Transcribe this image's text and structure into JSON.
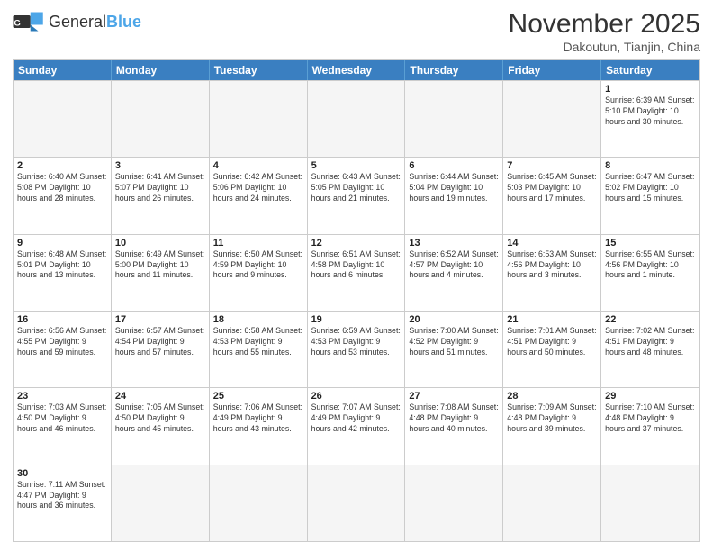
{
  "header": {
    "logo_general": "General",
    "logo_blue": "Blue",
    "month_title": "November 2025",
    "location": "Dakoutun, Tianjin, China"
  },
  "days_of_week": [
    "Sunday",
    "Monday",
    "Tuesday",
    "Wednesday",
    "Thursday",
    "Friday",
    "Saturday"
  ],
  "weeks": [
    [
      {
        "day": "",
        "info": "",
        "empty": true
      },
      {
        "day": "",
        "info": "",
        "empty": true
      },
      {
        "day": "",
        "info": "",
        "empty": true
      },
      {
        "day": "",
        "info": "",
        "empty": true
      },
      {
        "day": "",
        "info": "",
        "empty": true
      },
      {
        "day": "",
        "info": "",
        "empty": true
      },
      {
        "day": "1",
        "info": "Sunrise: 6:39 AM\nSunset: 5:10 PM\nDaylight: 10 hours and 30 minutes.",
        "empty": false
      }
    ],
    [
      {
        "day": "2",
        "info": "Sunrise: 6:40 AM\nSunset: 5:08 PM\nDaylight: 10 hours and 28 minutes.",
        "empty": false
      },
      {
        "day": "3",
        "info": "Sunrise: 6:41 AM\nSunset: 5:07 PM\nDaylight: 10 hours and 26 minutes.",
        "empty": false
      },
      {
        "day": "4",
        "info": "Sunrise: 6:42 AM\nSunset: 5:06 PM\nDaylight: 10 hours and 24 minutes.",
        "empty": false
      },
      {
        "day": "5",
        "info": "Sunrise: 6:43 AM\nSunset: 5:05 PM\nDaylight: 10 hours and 21 minutes.",
        "empty": false
      },
      {
        "day": "6",
        "info": "Sunrise: 6:44 AM\nSunset: 5:04 PM\nDaylight: 10 hours and 19 minutes.",
        "empty": false
      },
      {
        "day": "7",
        "info": "Sunrise: 6:45 AM\nSunset: 5:03 PM\nDaylight: 10 hours and 17 minutes.",
        "empty": false
      },
      {
        "day": "8",
        "info": "Sunrise: 6:47 AM\nSunset: 5:02 PM\nDaylight: 10 hours and 15 minutes.",
        "empty": false
      }
    ],
    [
      {
        "day": "9",
        "info": "Sunrise: 6:48 AM\nSunset: 5:01 PM\nDaylight: 10 hours and 13 minutes.",
        "empty": false
      },
      {
        "day": "10",
        "info": "Sunrise: 6:49 AM\nSunset: 5:00 PM\nDaylight: 10 hours and 11 minutes.",
        "empty": false
      },
      {
        "day": "11",
        "info": "Sunrise: 6:50 AM\nSunset: 4:59 PM\nDaylight: 10 hours and 9 minutes.",
        "empty": false
      },
      {
        "day": "12",
        "info": "Sunrise: 6:51 AM\nSunset: 4:58 PM\nDaylight: 10 hours and 6 minutes.",
        "empty": false
      },
      {
        "day": "13",
        "info": "Sunrise: 6:52 AM\nSunset: 4:57 PM\nDaylight: 10 hours and 4 minutes.",
        "empty": false
      },
      {
        "day": "14",
        "info": "Sunrise: 6:53 AM\nSunset: 4:56 PM\nDaylight: 10 hours and 3 minutes.",
        "empty": false
      },
      {
        "day": "15",
        "info": "Sunrise: 6:55 AM\nSunset: 4:56 PM\nDaylight: 10 hours and 1 minute.",
        "empty": false
      }
    ],
    [
      {
        "day": "16",
        "info": "Sunrise: 6:56 AM\nSunset: 4:55 PM\nDaylight: 9 hours and 59 minutes.",
        "empty": false
      },
      {
        "day": "17",
        "info": "Sunrise: 6:57 AM\nSunset: 4:54 PM\nDaylight: 9 hours and 57 minutes.",
        "empty": false
      },
      {
        "day": "18",
        "info": "Sunrise: 6:58 AM\nSunset: 4:53 PM\nDaylight: 9 hours and 55 minutes.",
        "empty": false
      },
      {
        "day": "19",
        "info": "Sunrise: 6:59 AM\nSunset: 4:53 PM\nDaylight: 9 hours and 53 minutes.",
        "empty": false
      },
      {
        "day": "20",
        "info": "Sunrise: 7:00 AM\nSunset: 4:52 PM\nDaylight: 9 hours and 51 minutes.",
        "empty": false
      },
      {
        "day": "21",
        "info": "Sunrise: 7:01 AM\nSunset: 4:51 PM\nDaylight: 9 hours and 50 minutes.",
        "empty": false
      },
      {
        "day": "22",
        "info": "Sunrise: 7:02 AM\nSunset: 4:51 PM\nDaylight: 9 hours and 48 minutes.",
        "empty": false
      }
    ],
    [
      {
        "day": "23",
        "info": "Sunrise: 7:03 AM\nSunset: 4:50 PM\nDaylight: 9 hours and 46 minutes.",
        "empty": false
      },
      {
        "day": "24",
        "info": "Sunrise: 7:05 AM\nSunset: 4:50 PM\nDaylight: 9 hours and 45 minutes.",
        "empty": false
      },
      {
        "day": "25",
        "info": "Sunrise: 7:06 AM\nSunset: 4:49 PM\nDaylight: 9 hours and 43 minutes.",
        "empty": false
      },
      {
        "day": "26",
        "info": "Sunrise: 7:07 AM\nSunset: 4:49 PM\nDaylight: 9 hours and 42 minutes.",
        "empty": false
      },
      {
        "day": "27",
        "info": "Sunrise: 7:08 AM\nSunset: 4:48 PM\nDaylight: 9 hours and 40 minutes.",
        "empty": false
      },
      {
        "day": "28",
        "info": "Sunrise: 7:09 AM\nSunset: 4:48 PM\nDaylight: 9 hours and 39 minutes.",
        "empty": false
      },
      {
        "day": "29",
        "info": "Sunrise: 7:10 AM\nSunset: 4:48 PM\nDaylight: 9 hours and 37 minutes.",
        "empty": false
      }
    ],
    [
      {
        "day": "30",
        "info": "Sunrise: 7:11 AM\nSunset: 4:47 PM\nDaylight: 9 hours and 36 minutes.",
        "empty": false
      },
      {
        "day": "",
        "info": "",
        "empty": true
      },
      {
        "day": "",
        "info": "",
        "empty": true
      },
      {
        "day": "",
        "info": "",
        "empty": true
      },
      {
        "day": "",
        "info": "",
        "empty": true
      },
      {
        "day": "",
        "info": "",
        "empty": true
      },
      {
        "day": "",
        "info": "",
        "empty": true
      }
    ]
  ]
}
